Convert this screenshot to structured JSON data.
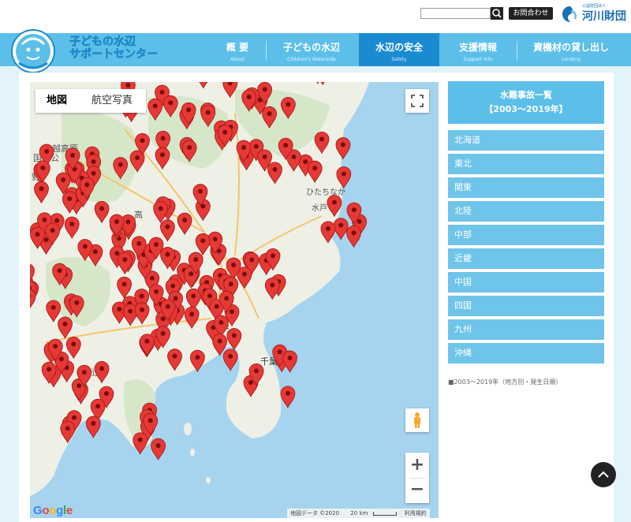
{
  "search": {
    "placeholder": ""
  },
  "utility": {
    "contact_label": "お問合わせ",
    "foundation_subtitle": "公益財団法人",
    "foundation_name": "河川財団"
  },
  "site": {
    "title_line1": "子どもの水辺",
    "title_line2": "サポートセンター"
  },
  "nav": [
    {
      "ja": "概 要",
      "en": "About",
      "active": false
    },
    {
      "ja": "子どもの水辺",
      "en": "Children's Waterside",
      "active": false
    },
    {
      "ja": "水辺の安全",
      "en": "Safety",
      "active": true
    },
    {
      "ja": "支援情報",
      "en": "Support Info",
      "active": false
    },
    {
      "ja": "資機材の貸し出し",
      "en": "Lending",
      "active": false
    }
  ],
  "map": {
    "type_tabs": [
      {
        "label": "地図",
        "selected": true
      },
      {
        "label": "航空写真",
        "selected": false
      }
    ],
    "zoom_in": "+",
    "zoom_out": "−",
    "google": "Google",
    "attribution": "地図データ ©2020",
    "scale_label": "20 km",
    "terms": "利用規約",
    "place_labels": [
      "国立公",
      "越高原",
      "野",
      "伊勢",
      "ひたちなか",
      "水戸",
      "高",
      "浜",
      "千葉県",
      "辻",
      "岡"
    ],
    "pin_color": "#e53935"
  },
  "sidebar": {
    "heading_line1": "水難事故一覧",
    "heading_line2": "【2003〜2019年】",
    "regions": [
      "北海道",
      "東北",
      "関東",
      "北陸",
      "中部",
      "近畿",
      "中国",
      "四国",
      "九州",
      "沖縄"
    ],
    "note": "■2003〜2019年（地方別・発生日順）"
  },
  "colors": {
    "header": "#5cbfe9",
    "nav_active": "#1a8bd0",
    "region_button": "#6fc4ea",
    "sea": "#a6d4ef",
    "land": "#eef0e6"
  }
}
